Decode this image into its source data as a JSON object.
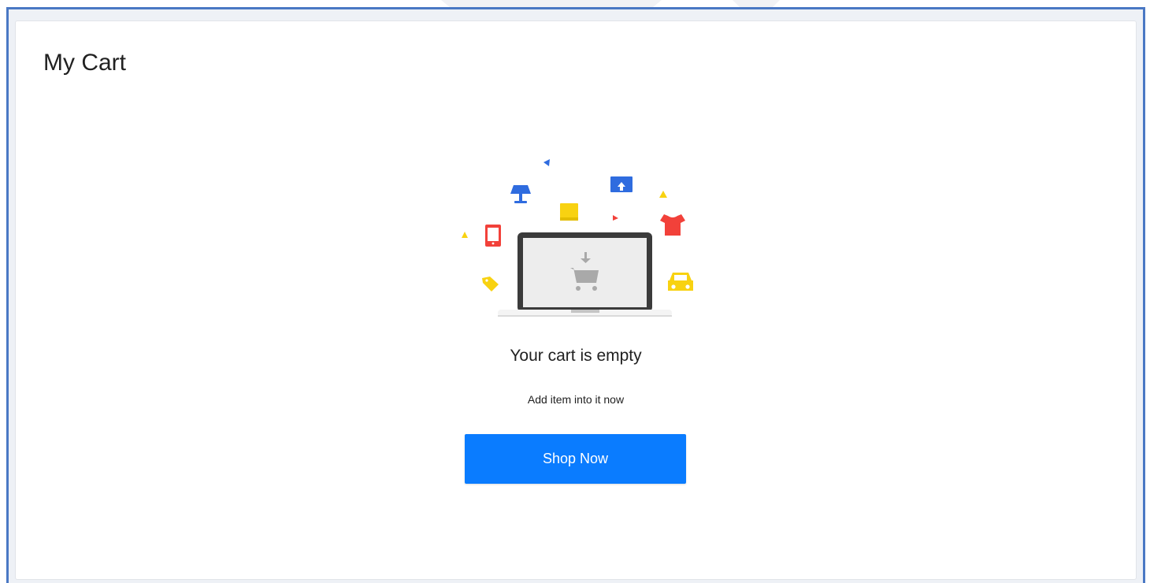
{
  "page": {
    "title": "My Cart"
  },
  "empty_state": {
    "illustration": "empty-cart-laptop-illustration",
    "heading": "Your cart is empty",
    "subtext": "Add item into it now",
    "cta_label": "Shop Now"
  },
  "colors": {
    "frame_border": "#4a78c4",
    "cta_background": "#0a7cff",
    "icon_blue": "#2f6cdf",
    "icon_red": "#f2413a",
    "icon_yellow": "#f8d211",
    "laptop_dark": "#3b3b3b"
  }
}
